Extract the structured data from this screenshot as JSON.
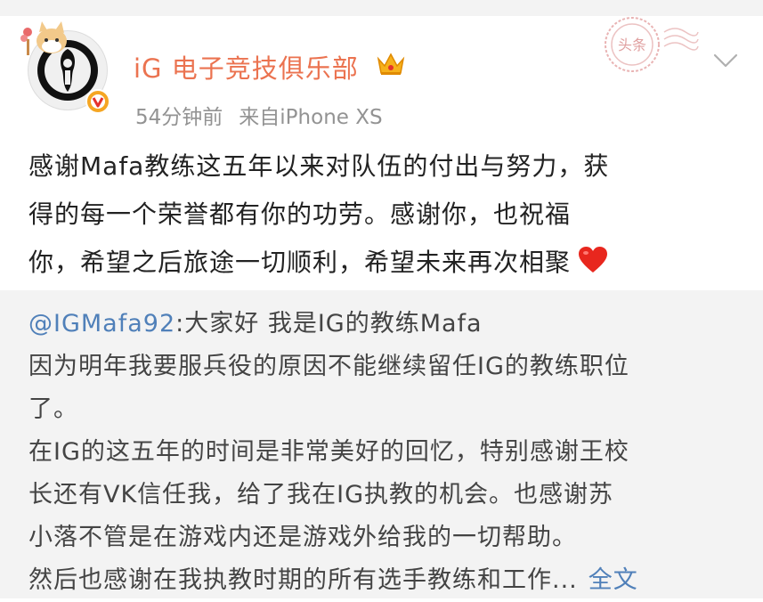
{
  "post": {
    "author": "iG 电子竞技俱乐部",
    "time": "54分钟前",
    "source": "来自iPhone XS",
    "stamp_text": "头条",
    "text_lines": [
      "感谢Mafa教练这五年以来对队伍的付出与努力，获",
      "得的每一个荣誉都有你的功劳。感谢你，也祝福",
      "你，希望之后旅途一切顺利，希望未来再次相聚"
    ],
    "emoji": "heart-emoji"
  },
  "repost": {
    "mention": "@IGMafa92",
    "first_line_rest": ":大家好 我是IG的教练Mafa",
    "lines": [
      "因为明年我要服兵役的原因不能继续留任IG的教练职位",
      "了。",
      "在IG的这五年的时间是非常美好的回忆，特别感谢王校",
      "长还有VK信任我，给了我在IG执教的机会。也感谢苏",
      "小落不管是在游戏内还是游戏外给我的一切帮助。"
    ],
    "last_line": "然后也感谢在我执教时期的所有选手教练和工作...",
    "full_text_link": "全文"
  },
  "colors": {
    "accent_name": "#eb7350",
    "link": "#5080b9",
    "meta": "#939393",
    "repost_bg": "#f3f3f3"
  },
  "icons": [
    "ig-logo-avatar",
    "cat-decoration-icon",
    "vip-verified-icon",
    "crown-icon",
    "toutiao-stamp-icon",
    "chevron-down-icon",
    "heart-emoji"
  ]
}
